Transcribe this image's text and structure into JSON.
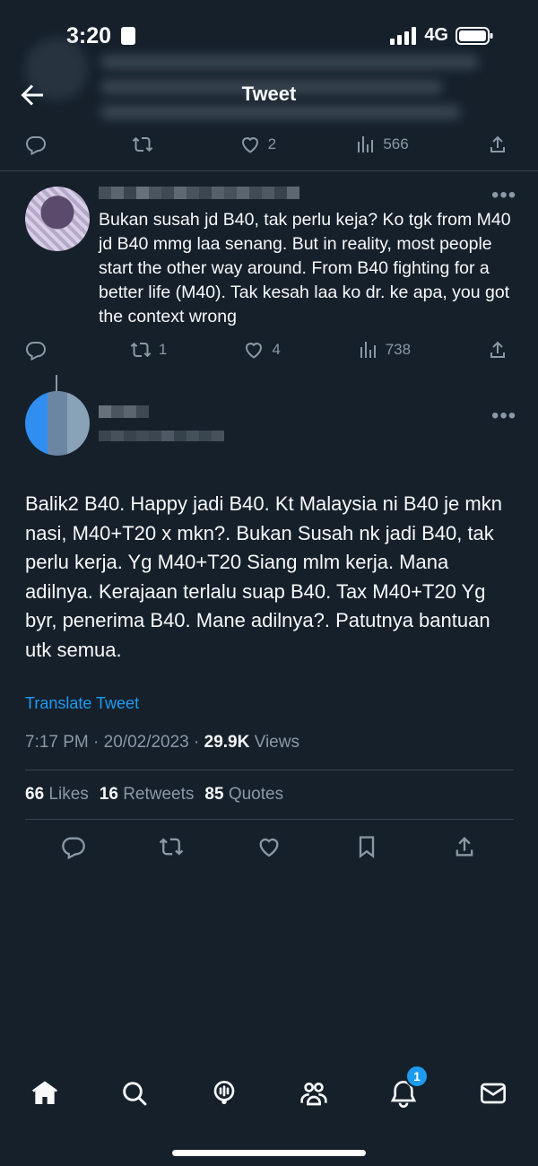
{
  "status_bar": {
    "time": "3:20",
    "network": "4G"
  },
  "header": {
    "title": "Tweet"
  },
  "prev_tweet": {
    "actions": {
      "replies": "",
      "retweets": "",
      "likes": "2",
      "views": "566"
    }
  },
  "reply_tweet": {
    "text": "Bukan susah jd B40, tak perlu keja? Ko tgk from M40 jd B40 mmg laa senang. But in reality, most people start the other way around. From B40 fighting for a better life (M40). Tak kesah laa ko dr. ke apa, you got the context wrong",
    "actions": {
      "replies": "",
      "retweets": "1",
      "likes": "4",
      "views": "738"
    }
  },
  "main_tweet": {
    "text": "Balik2 B40. Happy jadi B40. Kt Malaysia ni B40 je mkn nasi, M40+T20 x mkn?. Bukan Susah nk jadi B40, tak perlu kerja. Yg M40+T20 Siang mlm kerja. Mana adilnya. Kerajaan terlalu suap B40. Tax M40+T20 Yg byr, penerima B40. Mane adilnya?. Patutnya bantuan utk semua.",
    "translate_label": "Translate Tweet",
    "time": "7:17 PM",
    "date": "20/02/2023",
    "views_count": "29.9K",
    "views_label": "Views",
    "likes_count": "66",
    "likes_label": "Likes",
    "retweets_count": "16",
    "retweets_label": "Retweets",
    "quotes_count": "85",
    "quotes_label": "Quotes"
  },
  "nav": {
    "notifications_badge": "1"
  },
  "icons": [
    "back-arrow-icon",
    "reply-icon",
    "retweet-icon",
    "like-icon",
    "views-icon",
    "share-icon",
    "bookmark-icon",
    "home-icon",
    "search-icon",
    "spaces-icon",
    "communities-icon",
    "notifications-icon",
    "messages-icon"
  ],
  "colors": {
    "background": "#15202b",
    "accent": "#1d9bf0",
    "muted": "#8b98a5"
  }
}
